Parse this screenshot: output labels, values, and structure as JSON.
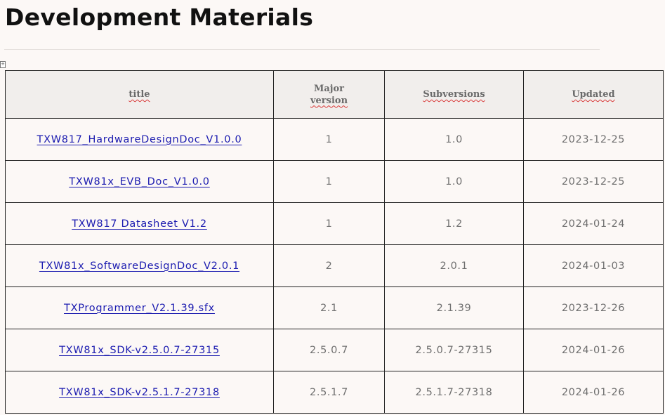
{
  "page": {
    "title": "Development Materials"
  },
  "table": {
    "headers": {
      "title": "title",
      "major_line1": "Major",
      "major_line2": "version",
      "subversions": "Subversions",
      "updated": "Updated"
    },
    "rows": [
      {
        "title": "TXW817_HardwareDesignDoc_V1.0.0",
        "major": "1",
        "sub": "1.0",
        "updated": "2023-12-25"
      },
      {
        "title": "TXW81x_EVB_Doc_V1.0.0",
        "major": "1",
        "sub": "1.0",
        "updated": "2023-12-25"
      },
      {
        "title": "TXW817 Datasheet V1.2",
        "major": "1",
        "sub": "1.2",
        "updated": "2024-01-24"
      },
      {
        "title": "TXW81x_SoftwareDesignDoc_V2.0.1",
        "major": "2",
        "sub": "2.0.1",
        "updated": "2024-01-03"
      },
      {
        "title": "TXProgrammer_V2.1.39.sfx",
        "major": "2.1",
        "sub": "2.1.39",
        "updated": "2023-12-26"
      },
      {
        "title": "TXW81x_SDK-v2.5.0.7-27315",
        "major": "2.5.0.7",
        "sub": "2.5.0.7-27315",
        "updated": "2024-01-26"
      },
      {
        "title": "TXW81x_SDK-v2.5.1.7-27318",
        "major": "2.5.1.7",
        "sub": "2.5.1.7-27318",
        "updated": "2024-01-26"
      }
    ]
  },
  "icons": {
    "table_anchor": "table-move-handle-icon"
  },
  "colors": {
    "background": "#fcf8f6",
    "link": "#1b1bb0",
    "header_bg": "#f1eeec",
    "spellcheck": "#d93a3a"
  }
}
